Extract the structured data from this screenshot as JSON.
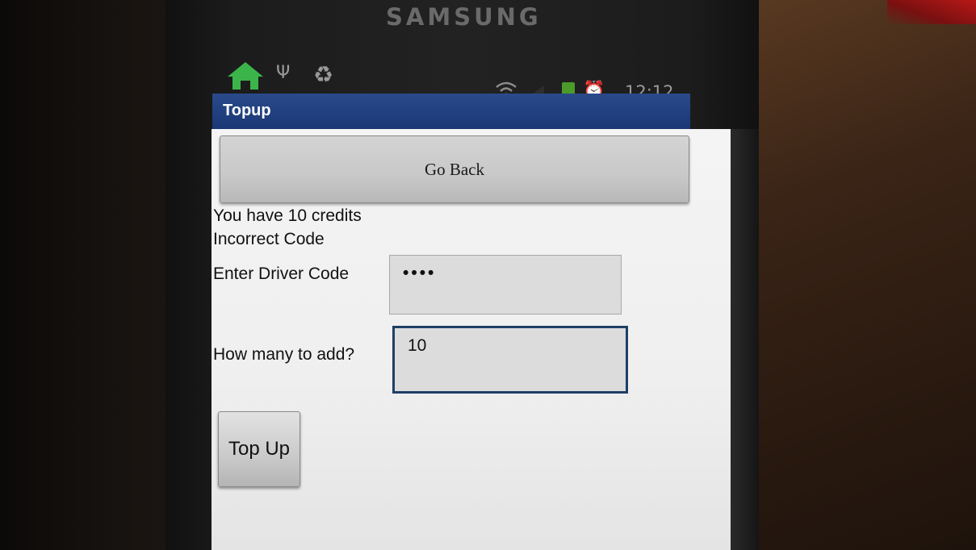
{
  "device": {
    "brand": "SAMSUNG"
  },
  "statusbar": {
    "time": "12:12",
    "icons": [
      "home-icon",
      "usb-icon",
      "recycle-icon",
      "wifi-icon",
      "signal-icon",
      "battery-charging-icon",
      "alarm-icon"
    ],
    "home_icon_color": "#3bb54a"
  },
  "app": {
    "title": "Topup",
    "titlebar_color": "#1c3a78"
  },
  "buttons": {
    "go_back": "Go Back",
    "top_up": "Top Up"
  },
  "messages": {
    "credits": "You have 10 credits",
    "error": "Incorrect Code"
  },
  "form": {
    "driver_code_label": "Enter Driver Code",
    "driver_code_value": "••••",
    "amount_label": "How many to add?",
    "amount_value": "10"
  }
}
